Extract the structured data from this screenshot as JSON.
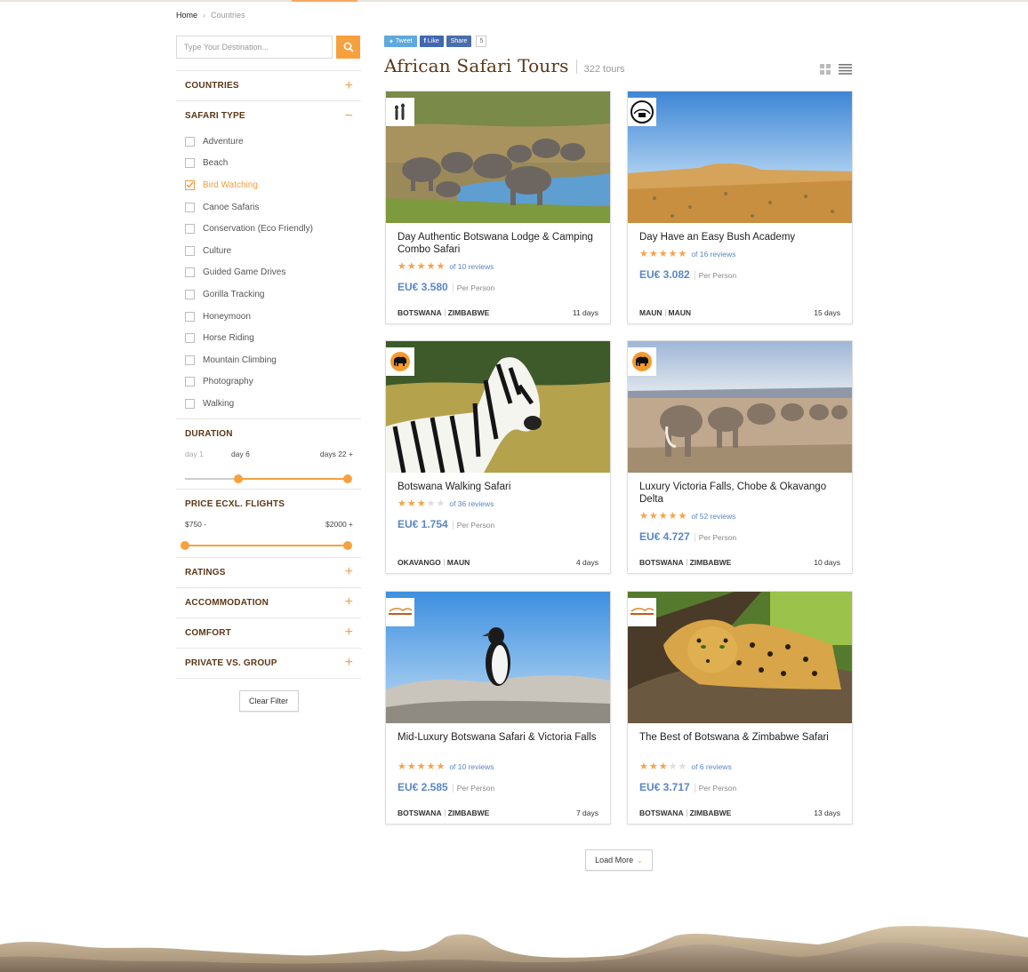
{
  "breadcrumb": {
    "home": "Home",
    "current": "Countries"
  },
  "search": {
    "placeholder": "Type Your Destination..."
  },
  "filters": {
    "countries": "COUNTRIES",
    "safari_type": "SAFARI TYPE",
    "safari_types": [
      {
        "label": "Adventure",
        "checked": false
      },
      {
        "label": "Beach",
        "checked": false
      },
      {
        "label": "Bird Watching",
        "checked": true
      },
      {
        "label": "Canoe Safaris",
        "checked": false
      },
      {
        "label": "Conservation (Eco Friendly)",
        "checked": false
      },
      {
        "label": "Culture",
        "checked": false
      },
      {
        "label": "Guided Game Drives",
        "checked": false
      },
      {
        "label": "Gorilla Tracking",
        "checked": false
      },
      {
        "label": "Honeymoon",
        "checked": false
      },
      {
        "label": "Horse Riding",
        "checked": false
      },
      {
        "label": "Mountain Climbing",
        "checked": false
      },
      {
        "label": "Photography",
        "checked": false
      },
      {
        "label": "Walking",
        "checked": false
      }
    ],
    "duration": {
      "title": "DURATION",
      "min_label": "day 1",
      "mid_label": "day 6",
      "max_label": "days 22 +",
      "from_fraction": 0.33,
      "to_fraction": 1.0
    },
    "price": {
      "title": "PRICE ECXL. FLIGHTS",
      "min_label": "$750 -",
      "max_label": "$2000 +",
      "from_fraction": 0.0,
      "to_fraction": 1.0
    },
    "ratings": "RATINGS",
    "accommodation": "ACCOMMODATION",
    "comfort": "COMFORT",
    "private_group": "PRIVATE VS. GROUP",
    "clear": "Clear Filter"
  },
  "share": {
    "tweet": "Tweet",
    "like": "Like",
    "share": "Share",
    "count": "5"
  },
  "page": {
    "title": "African Safari Tours",
    "count": "322 tours"
  },
  "colors": {
    "accent": "#f7a13e",
    "brown": "#5b3716",
    "price_blue": "#5a86c5"
  },
  "tours": [
    {
      "title": "Day Authentic Botswana Lodge & Camping Combo Safari",
      "stars": 5,
      "reviews": "of 10 reviews",
      "price": "EU€ 3.580",
      "per": "Per Person",
      "countries": [
        "BOTSWANA",
        "ZIMBABWE"
      ],
      "days": "11 days",
      "image": "elephants-waterhole",
      "logo": "meerkat-logo"
    },
    {
      "title": "Day Have an Easy Bush Academy",
      "stars": 5,
      "reviews": "of 16 reviews",
      "price": "EU€ 3.082",
      "per": "Per Person",
      "countries": [
        "MAUN",
        "MAUN"
      ],
      "days": "15 days",
      "image": "desert-plain",
      "logo": "circle-safaris-logo"
    },
    {
      "title": "Botswana Walking Safari",
      "stars": 3,
      "reviews": "of 36 reviews",
      "price": "EU€ 1.754",
      "per": "Per Person",
      "countries": [
        "OKAVANGO",
        "MAUN"
      ],
      "days": "4 days",
      "image": "zebra",
      "logo": "elephant-logo"
    },
    {
      "title": "Luxury Victoria Falls, Chobe & Okavango Delta",
      "stars": 5,
      "reviews": "of 52 reviews",
      "price": "EU€ 4.727",
      "per": "Per Person",
      "countries": [
        "BOTSWANA",
        "ZIMBABWE"
      ],
      "days": "10 days",
      "image": "elephant-herd",
      "logo": "elephant-logo"
    },
    {
      "title": "Mid-Luxury Botswana Safari & Victoria Falls",
      "stars": 5,
      "reviews": "of 10 reviews",
      "price": "EU€ 2.585",
      "per": "Per Person",
      "countries": [
        "BOTSWANA",
        "ZIMBABWE"
      ],
      "days": "7 days",
      "image": "penguin",
      "logo": "adventura-logo"
    },
    {
      "title": "The Best of Botswana & Zimbabwe Safari",
      "stars": 3,
      "reviews": "of 6 reviews",
      "price": "EU€ 3.717",
      "per": "Per Person",
      "countries": [
        "BOTSWANA",
        "ZIMBABWE"
      ],
      "days": "13 days",
      "image": "leopard",
      "logo": "adventura-logo"
    }
  ],
  "load_more": "Load More"
}
